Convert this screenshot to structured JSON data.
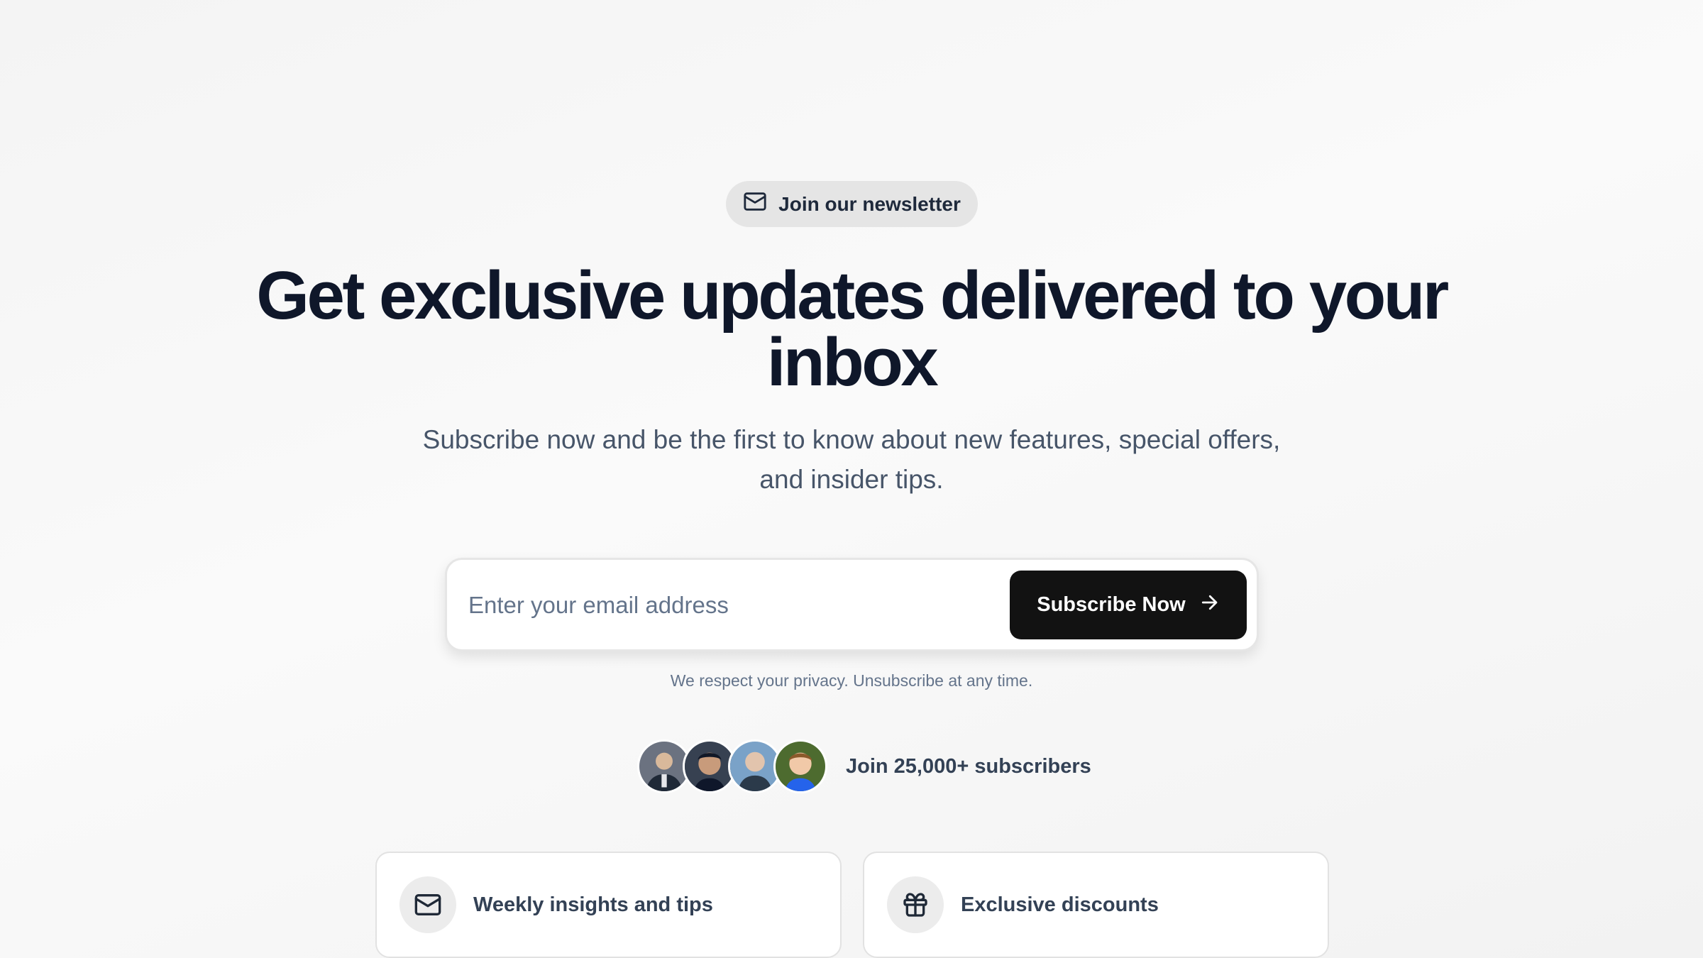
{
  "badge": {
    "label": "Join our newsletter",
    "icon": "mail-icon"
  },
  "headline": "Get exclusive updates delivered to your inbox",
  "subheadline": "Subscribe now and be the first to know about new features, special offers, and insider tips.",
  "form": {
    "email_placeholder": "Enter your email address",
    "email_value": "",
    "submit_label": "Subscribe Now",
    "submit_icon": "arrow-right-icon"
  },
  "privacy_note": "We respect your privacy. Unsubscribe at any time.",
  "social_proof": {
    "label": "Join 25,000+ subscribers",
    "avatars": [
      "subscriber-avatar-1",
      "subscriber-avatar-2",
      "subscriber-avatar-3",
      "subscriber-avatar-4"
    ]
  },
  "features": [
    {
      "label": "Weekly insights and tips",
      "icon": "mail-icon"
    },
    {
      "label": "Exclusive discounts",
      "icon": "gift-icon"
    }
  ],
  "colors": {
    "button_bg": "#121212",
    "headline": "#0f172a",
    "body_text": "#475569",
    "badge_bg": "#e5e5e5"
  }
}
